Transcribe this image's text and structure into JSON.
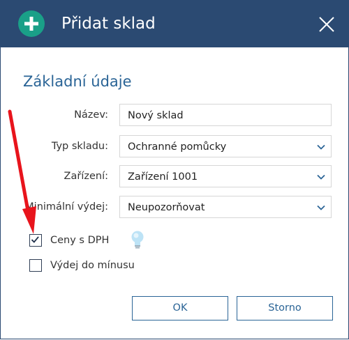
{
  "dialog": {
    "title": "Přidat sklad",
    "section_title": "Základní údaje"
  },
  "form": {
    "name_label": "Název:",
    "name_value": "Nový sklad",
    "type_label": "Typ skladu:",
    "type_value": "Ochranné pomůcky",
    "device_label": "Zařízení:",
    "device_value": "Zařízení 1001",
    "min_issue_label": "Minimální výdej:",
    "min_issue_value": "Neupozorňovat",
    "prices_vat_label": "Ceny s DPH",
    "prices_vat_checked": true,
    "negative_issue_label": "Výdej do mínusu",
    "negative_issue_checked": false
  },
  "buttons": {
    "ok_label": "OK",
    "cancel_label": "Storno"
  },
  "icons": {
    "title_icon": "plus-circle-icon",
    "close_icon": "close-icon",
    "dropdown_icon": "chevron-down-icon",
    "hint_icon": "lightbulb-icon",
    "annotation": "red-arrow"
  },
  "colors": {
    "titlebar": "#2b4a72",
    "accent": "#2a6496",
    "plus_green": "#1aa088",
    "annotation_red": "#e8141c"
  }
}
